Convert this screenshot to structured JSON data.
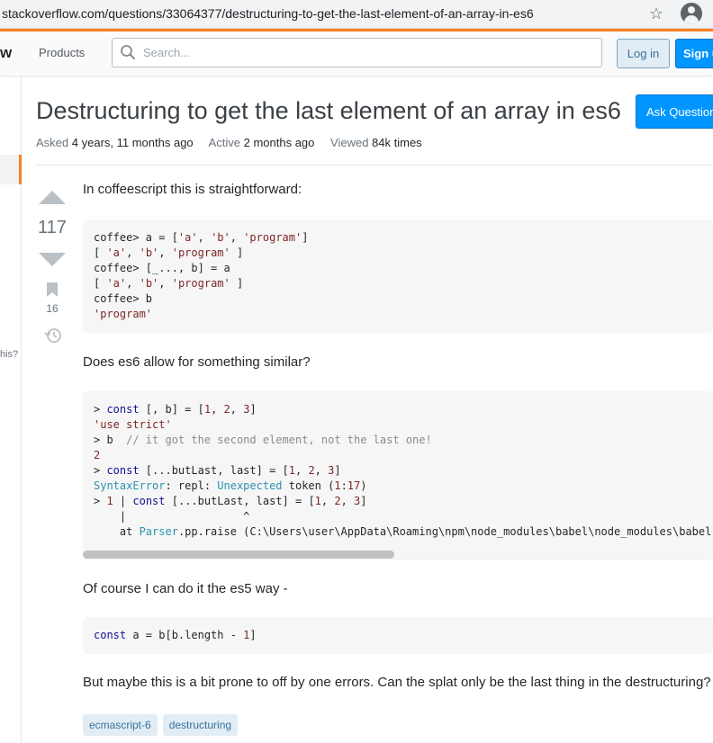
{
  "browser": {
    "url": "stackoverflow.com/questions/33064377/destructuring-to-get-the-last-element-of-an-array-in-es6"
  },
  "topbar": {
    "logo_fragment": "w",
    "products_label": "Products",
    "search_placeholder": "Search...",
    "login_label": "Log in",
    "signup_label": "Sign up"
  },
  "sidebar": {
    "fragment_text": "his?"
  },
  "question": {
    "title": "Destructuring to get the last element of an array in es6",
    "ask_button_label": "Ask Question",
    "meta": {
      "asked_label": "Asked",
      "asked_value": "4 years, 11 months ago",
      "active_label": "Active",
      "active_value": "2 months ago",
      "viewed_label": "Viewed",
      "viewed_value": "84k times"
    },
    "votes": "117",
    "bookmarks": "16",
    "paragraphs": [
      "In coffeescript this is straightforward:",
      "Does es6 allow for something similar?",
      "Of course I can do it the es5 way -",
      "But maybe this is a bit prone to off by one errors. Can the splat only be the last thing in the destructuring?"
    ],
    "code_block_1": [
      "coffee> a = ['a', 'b', 'program']",
      "[ 'a', 'b', 'program' ]",
      "coffee> [_..., b] = a",
      "[ 'a', 'b', 'program' ]",
      "coffee> b",
      "'program'"
    ],
    "code_block_2": [
      "> const [, b] = [1, 2, 3]",
      "'use strict'",
      "> b  // it got the second element, not the last one!",
      "2",
      "> const [...butLast, last] = [1, 2, 3]",
      "SyntaxError: repl: Unexpected token (1:17)",
      "> 1 | const [...butLast, last] = [1, 2, 3]",
      "    |                  ^",
      "    at Parser.pp.raise (C:\\Users\\user\\AppData\\Roaming\\npm\\node_modules\\babel\\node_modules\\babel-"
    ],
    "code_block_3": "const a = b[b.length - 1]",
    "tags": [
      "ecmascript-6",
      "destructuring"
    ]
  },
  "colors": {
    "accent_orange": "#f48024",
    "primary_blue": "#0095ff",
    "tag_bg": "#e1ecf4",
    "tag_text": "#39739d"
  }
}
